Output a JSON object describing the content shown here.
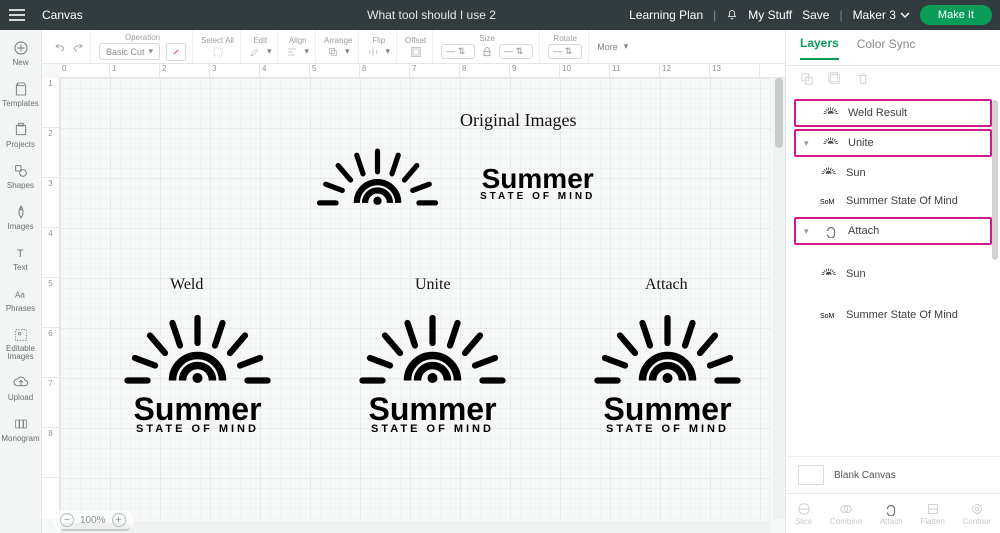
{
  "topbar": {
    "app": "Canvas",
    "doc": "What tool should I use 2",
    "learning": "Learning Plan",
    "mystuff": "My Stuff",
    "save": "Save",
    "machine": "Maker 3",
    "makeit": "Make It"
  },
  "leftrail": [
    {
      "id": "new",
      "label": "New"
    },
    {
      "id": "templates",
      "label": "Templates"
    },
    {
      "id": "projects",
      "label": "Projects"
    },
    {
      "id": "shapes",
      "label": "Shapes"
    },
    {
      "id": "images",
      "label": "Images"
    },
    {
      "id": "text",
      "label": "Text"
    },
    {
      "id": "phrases",
      "label": "Phrases"
    },
    {
      "id": "editable",
      "label": "Editable Images"
    },
    {
      "id": "upload",
      "label": "Upload"
    },
    {
      "id": "monogram",
      "label": "Monogram"
    }
  ],
  "toolbar": {
    "operation_label": "Operation",
    "operation_value": "Basic Cut",
    "selectall": "Select All",
    "edit": "Edit",
    "align": "Align",
    "arrange": "Arrange",
    "flip": "Flip",
    "offset": "Offset",
    "size": "Size",
    "rotate": "Rotate",
    "more": "More"
  },
  "ruler_h": [
    "0",
    "1",
    "2",
    "3",
    "4",
    "5",
    "6",
    "7",
    "8",
    "9",
    "10",
    "11",
    "12",
    "13"
  ],
  "ruler_v": [
    "1",
    "2",
    "3",
    "4",
    "5",
    "6",
    "7",
    "8"
  ],
  "canvas": {
    "title_original": "Original Images",
    "label_weld": "Weld",
    "label_unite": "Unite",
    "label_attach": "Attach",
    "summer_line1": "Summer",
    "summer_line2": "STATE OF MIND",
    "zoom": "100%"
  },
  "rightpanel": {
    "tab_layers": "Layers",
    "tab_colorsync": "Color Sync",
    "l_weld": "Weld Result",
    "l_unite": "Unite",
    "l_sun": "Sun",
    "l_som": "Summer State Of Mind",
    "l_attach": "Attach",
    "blank": "Blank Canvas",
    "btn_slice": "Slice",
    "btn_combine": "Combine",
    "btn_attach": "Attach",
    "btn_flatten": "Flatten",
    "btn_contour": "Contour"
  }
}
